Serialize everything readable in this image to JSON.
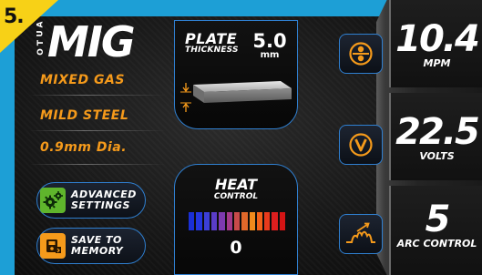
{
  "step": {
    "number": "5."
  },
  "mode": {
    "prefix_letters": [
      "A",
      "U",
      "T",
      "O"
    ],
    "title": "MIG"
  },
  "settings": {
    "gas": "MIXED GAS",
    "material": "MILD STEEL",
    "wire": "0.9mm Dia."
  },
  "buttons": {
    "advanced_line1": "ADVANCED",
    "advanced_line2": "SETTINGS",
    "save_line1": "SAVE TO",
    "save_line2": "MEMORY"
  },
  "plate": {
    "label_big": "PLATE",
    "label_small": "THICKNESS",
    "value": "5.0",
    "unit": "mm"
  },
  "heat": {
    "label_big": "HEAT",
    "label_small": "CONTROL",
    "value": "0",
    "bar_colors": [
      "#1a2fd6",
      "#2436e0",
      "#3c3fd8",
      "#5a3cc8",
      "#7d3ab0",
      "#a23a8a",
      "#c84a4a",
      "#e0682a",
      "#f08a1c",
      "#f2621a",
      "#e83a1c",
      "#dd1e1e",
      "#d41414"
    ]
  },
  "readouts": {
    "wire_speed": {
      "value": "10.4",
      "unit": "MPM"
    },
    "voltage": {
      "value": "22.5",
      "unit": "VOLTS"
    },
    "arc": {
      "value": "5",
      "unit": "ARC CONTROL"
    }
  },
  "colors": {
    "accent_orange": "#f59a1b",
    "accent_blue": "#2f7fd0",
    "tag_yellow": "#f7d117",
    "frame_blue": "#1d9fd6"
  },
  "icons": {
    "wire_speed_knob": "wire-feed-icon",
    "voltage_knob": "voltage-icon",
    "arc_knob": "arc-wave-icon",
    "advanced": "gears-icon",
    "save": "save-memory-icon"
  }
}
